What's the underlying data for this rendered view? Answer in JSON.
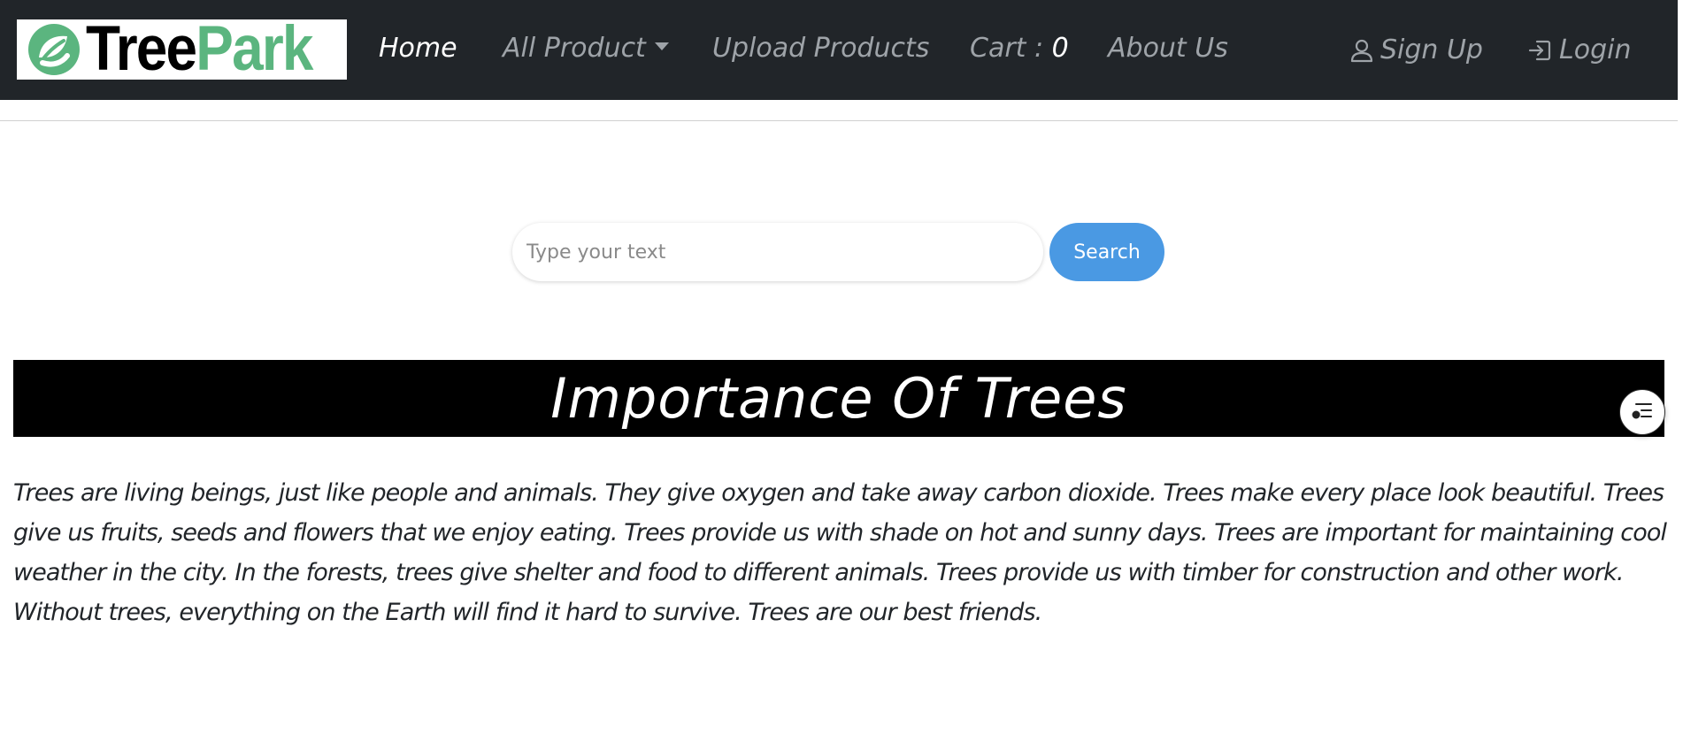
{
  "brand": {
    "part1": "Tree",
    "part2": "Park",
    "colors": {
      "tree": "#000000",
      "park": "#5bb57f"
    }
  },
  "nav": {
    "home": "Home",
    "all_product": "All Product",
    "upload_products": "Upload Products",
    "cart_label": "Cart : ",
    "cart_count": "0",
    "about_us": "About Us",
    "sign_up": "Sign Up",
    "login": "Login",
    "icons": {
      "sign_up": "user-icon",
      "login": "login-icon",
      "all_product": "caret-down-icon"
    }
  },
  "search": {
    "placeholder": "Type your text",
    "value": "",
    "button_label": "Search"
  },
  "section": {
    "title": "Importance Of Trees",
    "body": "Trees are living beings, just like people and animals. They give oxygen and take away carbon dioxide. Trees make every place look beautiful. Trees give us fruits, seeds and flowers that we enjoy eating. Trees provide us with shade on hot and sunny days. Trees are important for maintaining cool weather in the city. In the forests, trees give shelter and food to different animals. Trees provide us with timber for construction and other work. Without trees, everything on the Earth will find it hard to survive. Trees are our best friends."
  },
  "floating_button": {
    "icon": "filter-list-icon"
  },
  "colors": {
    "navbar_bg": "#212529",
    "nav_link": "#9ea3a8",
    "nav_active": "#ffffff",
    "search_button": "#4a99e3",
    "banner_bg": "#000000"
  }
}
